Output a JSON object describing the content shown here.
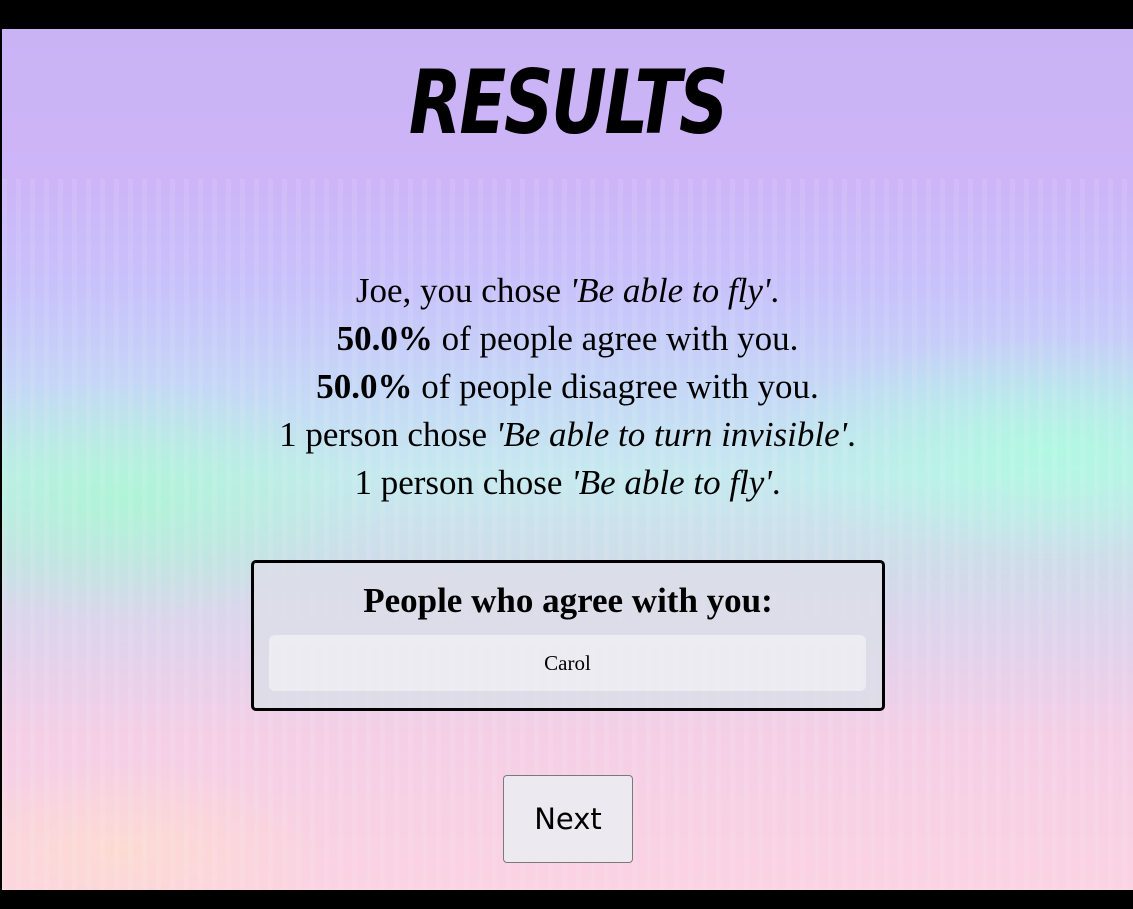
{
  "title": "RESULTS",
  "summary": {
    "line1": {
      "prefix": "Joe, you chose ",
      "choice": "'Be able to fly'",
      "suffix": "."
    },
    "line2": {
      "percent": "50.0%",
      "text": " of people agree with you."
    },
    "line3": {
      "percent": "50.0%",
      "text": " of people disagree with you."
    },
    "line4": {
      "prefix": "1 person chose ",
      "choice": "'Be able to turn invisible'",
      "suffix": "."
    },
    "line5": {
      "prefix": "1 person chose ",
      "choice": "'Be able to fly'",
      "suffix": "."
    }
  },
  "agree_section": {
    "heading": "People who agree with you:",
    "people": [
      "Carol"
    ]
  },
  "next_label": "Next"
}
